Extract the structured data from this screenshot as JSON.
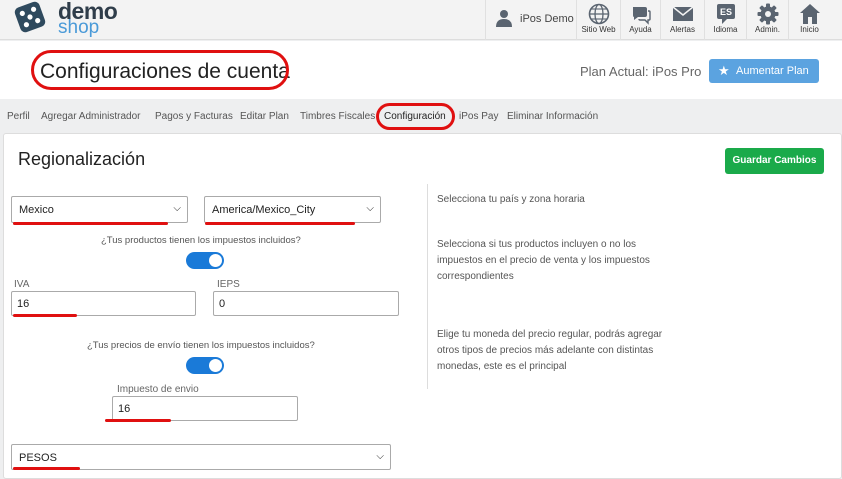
{
  "app": {
    "logo_top": "demo",
    "logo_bottom": "shop"
  },
  "user": {
    "name": "iPos Demo"
  },
  "nav": [
    {
      "label": "Sitio Web",
      "icon": "globe-icon"
    },
    {
      "label": "Ayuda",
      "icon": "chat-icon"
    },
    {
      "label": "Alertas",
      "icon": "envelope-icon"
    },
    {
      "label": "Idioma",
      "icon": "language-icon",
      "badge": "ES"
    },
    {
      "label": "Admin.",
      "icon": "gear-icon"
    },
    {
      "label": "Inicio",
      "icon": "home-icon"
    }
  ],
  "header": {
    "title": "Configuraciones de cuenta",
    "plan": "Plan Actual: iPos Pro",
    "upgrade_label": "Aumentar Plan"
  },
  "tabs": [
    "Perfil",
    "Agregar Administrador",
    "Pagos y Facturas",
    "Editar Plan",
    "Timbres Fiscales",
    "Configuración",
    "iPos Pay",
    "Eliminar Información"
  ],
  "active_tab": "Configuración",
  "section": {
    "title": "Regionalización",
    "save_label": "Guardar Cambios",
    "country": "Mexico",
    "timezone": "America/Mexico_City",
    "q_taxes_included": "¿Tus productos tienen los impuestos incluidos?",
    "taxes_included": true,
    "iva_label": "IVA",
    "iva_value": "16",
    "ieps_label": "IEPS",
    "ieps_value": "0",
    "q_shipping_taxes": "¿Tus precios de envío tienen los impuestos incluidos?",
    "shipping_taxes_included": true,
    "shipping_tax_label": "Impuesto de envio",
    "shipping_tax_value": "16",
    "currency": "PESOS"
  },
  "help": {
    "region": "Selecciona tu país y zona horaria",
    "taxes": "Selecciona si tus productos incluyen o no los impuestos en el precio de venta y los impuestos correspondientes",
    "currency": "Elige tu moneda del precio regular, podrás agregar otros tipos de precios más adelante con distintas monedas, este es el principal"
  },
  "colors": {
    "accent": "#5ba3e0",
    "save": "#1aaa4a",
    "toggle": "#1a7ad8",
    "annotation": "#e01010"
  }
}
